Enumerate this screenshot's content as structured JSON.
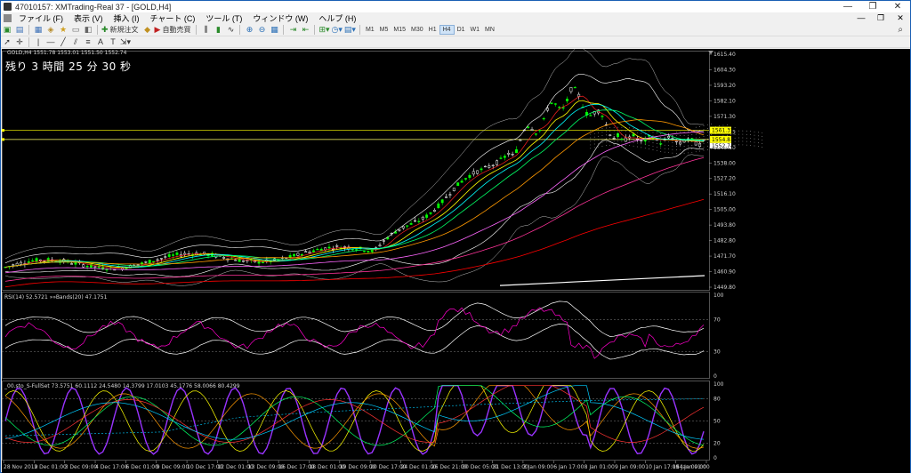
{
  "window": {
    "title": "47010157: XMTrading-Real 37 - [GOLD,H4]",
    "minimize": "—",
    "maximize": "❐",
    "close": "✕"
  },
  "menu": [
    "ファイル (F)",
    "表示 (V)",
    "挿入 (I)",
    "チャート (C)",
    "ツール (T)",
    "ウィンドウ (W)",
    "ヘルプ (H)"
  ],
  "menu_controls": [
    "—",
    "❐",
    "✕"
  ],
  "toolbar": {
    "new_order": "新規注文",
    "auto_trading": "自動売買",
    "timeframes": [
      "M1",
      "M5",
      "M15",
      "M30",
      "H1",
      "H4",
      "D1",
      "W1",
      "MN"
    ],
    "active_timeframe": "H4",
    "drawing_labels": [
      "A",
      "T"
    ]
  },
  "chart": {
    "header": "GOLD,H4  1551.78 1553.01 1551.50 1552.74",
    "countdown": "残り 3 時間 25 分 30 秒",
    "price_axis": [
      "1615.40",
      "1604.30",
      "1593.20",
      "1582.10",
      "1571.30",
      "1560.15",
      "1549.10",
      "1538.00",
      "1527.20",
      "1516.10",
      "1505.00",
      "1493.80",
      "1482.80",
      "1471.70",
      "1460.90",
      "1449.80"
    ],
    "price_tag_yellow": "1561.33",
    "price_tag_current": "1554.81",
    "price_tag_small": "1552.74",
    "rsi_header": "RSI(14) 52.5721   »»Bands(20) 47.1751",
    "rsi_axis": [
      "100",
      "70",
      "30",
      "0"
    ],
    "stoch_header": "_00.sto_S-FullSet 73.5751 60.1112 24.5480 14.3799 17.0103 45.1776 58.0066 80.4299",
    "stoch_axis": [
      "100",
      "80",
      "50",
      "20",
      "0"
    ],
    "time_axis": [
      "28 Nov 2019",
      "2 Dec 01:00",
      "3 Dec 09:00",
      "4 Dec 17:00",
      "6 Dec 01:00",
      "9 Dec 09:00",
      "10 Dec 17:00",
      "12 Dec 01:00",
      "13 Dec 09:00",
      "16 Dec 17:00",
      "18 Dec 01:00",
      "19 Dec 09:00",
      "20 Dec 17:00",
      "24 Dec 01:00",
      "26 Dec 21:00",
      "30 Dec 05:00",
      "31 Dec 13:00",
      "3 Jan 09:00",
      "6 Jan 17:00",
      "8 Jan 01:00",
      "9 Jan 09:00",
      "10 Jan 17:00",
      "14 Jan 01:00",
      "15 Jan 09:00"
    ]
  },
  "colors": {
    "background": "#000000",
    "bull_candle": "#00ff00",
    "bear_candle": "#ffffff",
    "grid": "#777777",
    "tag_yellow": "#ffff00"
  }
}
